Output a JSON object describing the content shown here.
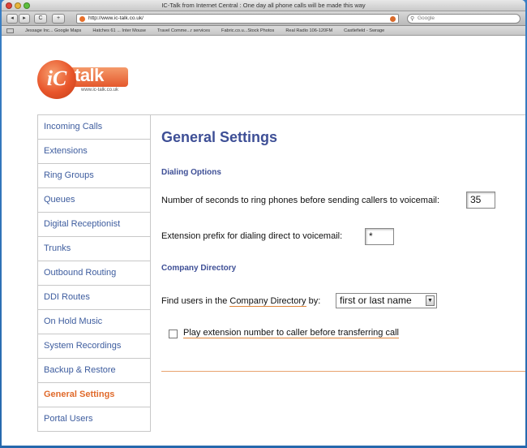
{
  "browser": {
    "window_title": "IC-Talk from Internet Central : One day all phone calls will be made this way",
    "url": "http://www.ic-talk.co.uk/",
    "search_placeholder": "Google",
    "back_label": "◂",
    "forward_label": "▸",
    "reload_label": "C",
    "add_label": "+",
    "bookmarks": [
      "Jessage Inc... Google Maps",
      "Hatches 61 ... Inter Mouse",
      "Travel Comme...r services",
      "Fabric.co.u...Stock Photos",
      "Real Radio 106-120FM",
      "Castlefield - Swrage"
    ]
  },
  "logo": {
    "letters": "iC",
    "wordmark": "talk",
    "url": "www.ic-talk.co.uk"
  },
  "nav": {
    "items": [
      {
        "label": "Incoming Calls"
      },
      {
        "label": "Extensions"
      },
      {
        "label": "Ring Groups"
      },
      {
        "label": "Queues"
      },
      {
        "label": "Digital Receptionist"
      },
      {
        "label": "Trunks"
      },
      {
        "label": "Outbound Routing"
      },
      {
        "label": "DDI Routes"
      },
      {
        "label": "On Hold Music"
      },
      {
        "label": "System Recordings"
      },
      {
        "label": "Backup & Restore"
      },
      {
        "label": "General Settings"
      },
      {
        "label": "Portal Users"
      }
    ],
    "active": "General Settings"
  },
  "main": {
    "title": "General Settings",
    "dialing_section": "Dialing Options",
    "ring_seconds_label": "Number of seconds to ring phones before sending callers to voicemail:",
    "ring_seconds_value": "35",
    "prefix_label": "Extension prefix for dialing direct to voicemail:",
    "prefix_value": "*",
    "directory_section": "Company Directory",
    "find_users_prefix": "Find users in the ",
    "find_users_link": "Company Directory",
    "find_users_suffix": " by:",
    "find_users_value": "first or last name",
    "play_extension_label": "Play extension number to caller before transferring call",
    "play_extension_checked": false
  },
  "colors": {
    "accent": "#e06a2b",
    "nav_text": "#3d5c9e",
    "heading": "#3e4f96",
    "frame": "#2a6fb6"
  }
}
